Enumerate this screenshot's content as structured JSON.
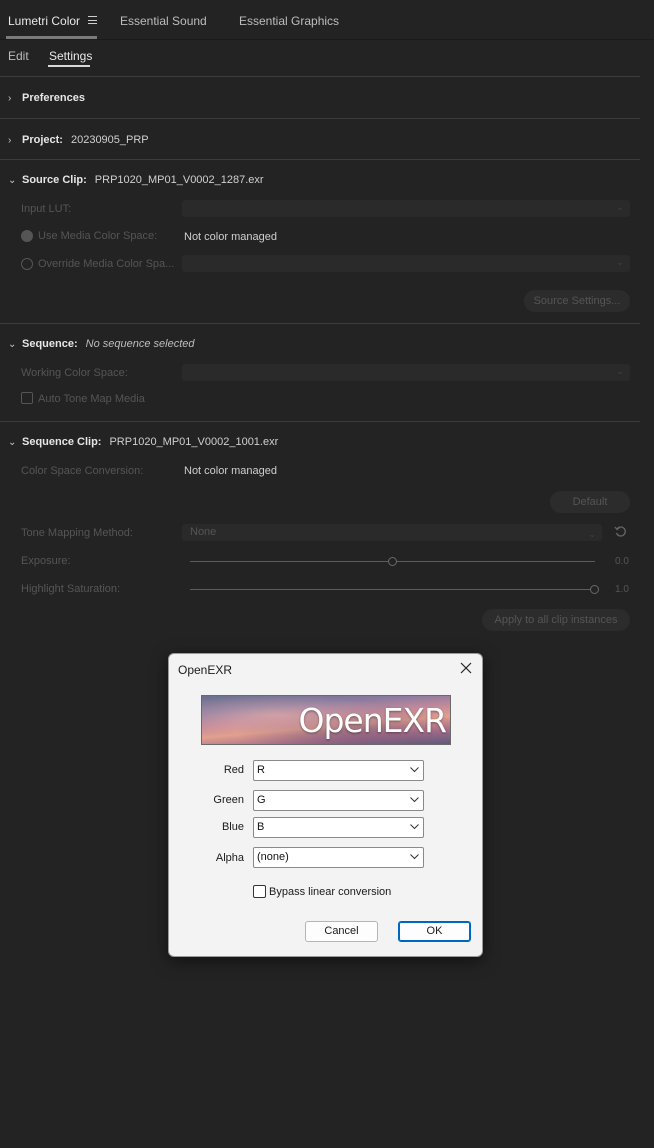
{
  "panel_tabs": [
    {
      "label": "Lumetri Color",
      "active": true
    },
    {
      "label": "Essential Sound",
      "active": false
    },
    {
      "label": "Essential Graphics",
      "active": false
    }
  ],
  "sub_tabs": [
    {
      "label": "Edit",
      "active": false
    },
    {
      "label": "Settings",
      "active": true
    }
  ],
  "preferences": {
    "title": "Preferences"
  },
  "project": {
    "title": "Project:",
    "value": "20230905_PRP"
  },
  "source_clip": {
    "title": "Source Clip:",
    "value": "PRP1020_MP01_V0002_1287.exr",
    "input_lut_label": "Input LUT:",
    "use_media_label": "Use Media Color Space:",
    "use_media_value": "Not color managed",
    "override_label": "Override Media Color Spa...",
    "source_settings_button": "Source Settings..."
  },
  "sequence": {
    "title": "Sequence:",
    "value": "No sequence selected",
    "working_space_label": "Working Color Space:",
    "auto_tone_map_label": "Auto Tone Map Media"
  },
  "sequence_clip": {
    "title": "Sequence Clip:",
    "value": "PRP1020_MP01_V0002_1001.exr",
    "conversion_label": "Color Space Conversion:",
    "conversion_value": "Not color managed",
    "default_button": "Default",
    "tone_mapping_label": "Tone Mapping Method:",
    "tone_mapping_value": "None",
    "exposure_label": "Exposure:",
    "exposure_value": "0.0",
    "exposure_position": 0.5,
    "highlight_label": "Highlight Saturation:",
    "highlight_value": "1.0",
    "highlight_position": 1.0,
    "apply_button": "Apply to all clip instances"
  },
  "dialog": {
    "title": "OpenEXR",
    "banner_text": "OpenEXR",
    "fields": [
      {
        "label": "Red",
        "value": "R"
      },
      {
        "label": "Green",
        "value": "G"
      },
      {
        "label": "Blue",
        "value": "B"
      },
      {
        "label": "Alpha",
        "value": "(none)"
      }
    ],
    "bypass_label": "Bypass linear conversion",
    "bypass_checked": false,
    "cancel_label": "Cancel",
    "ok_label": "OK"
  },
  "icons": [
    "hamburger-menu-icon",
    "chevron-right-icon",
    "chevron-down-icon",
    "reset-icon",
    "close-icon",
    "dropdown-arrow-icon"
  ]
}
